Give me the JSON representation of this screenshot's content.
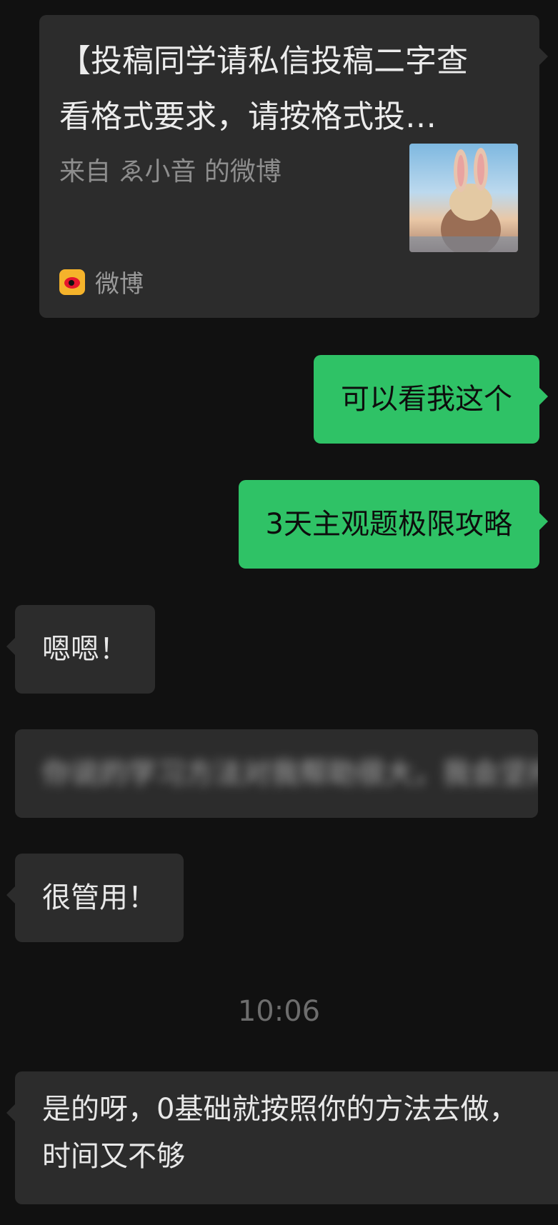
{
  "card": {
    "title_line1": "【投稿同学请私信投稿二字查",
    "title_line2": "看格式要求，请按格式投…",
    "description": "来自 ゑ小音 的微博",
    "source_icon": "weibo-icon",
    "source_label": "微博",
    "thumbnail": "rabbit-photo"
  },
  "messages": [
    {
      "side": "out",
      "text": "可以看我这个"
    },
    {
      "side": "out",
      "text": "3天主观题极限攻略"
    },
    {
      "side": "in",
      "text": "嗯嗯！"
    },
    {
      "side": "in",
      "text": "你说的学习方法对我帮助很大，我会坚持下去",
      "blurred": true
    },
    {
      "side": "in",
      "text": "很管用！"
    },
    {
      "side": "in",
      "text": "是的呀，0基础就按照你的方法去做，时间又不够"
    }
  ],
  "timestamp": "10:06",
  "colors": {
    "background": "#111111",
    "incoming_bubble": "#2c2c2c",
    "outgoing_bubble": "#2fc266"
  }
}
